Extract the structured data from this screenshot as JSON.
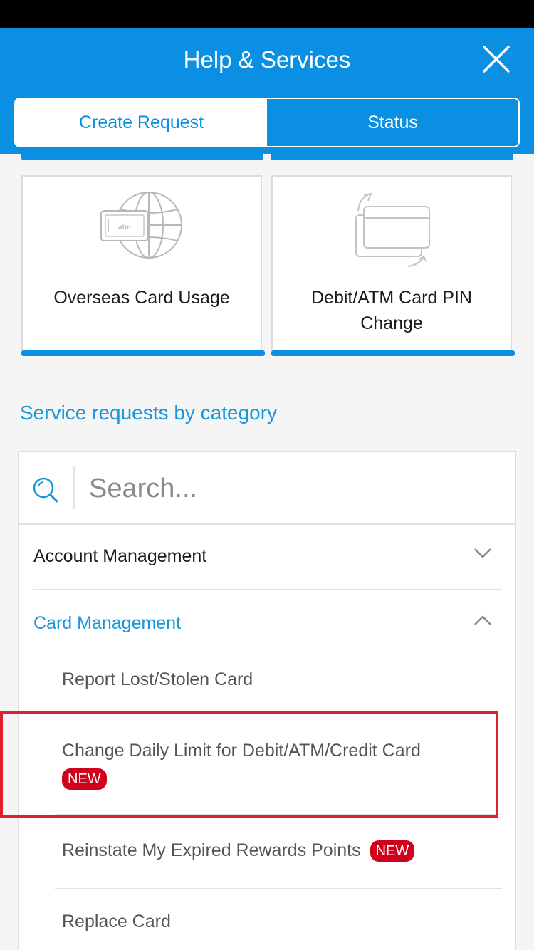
{
  "header": {
    "title": "Help & Services",
    "close_icon": "close-icon"
  },
  "tabs": [
    {
      "label": "Create Request",
      "active": true
    },
    {
      "label": "Status",
      "active": false
    }
  ],
  "tiles": [
    {
      "label": "Overseas Card Usage",
      "icon": "atm-card-globe-icon",
      "icon_text": "atm"
    },
    {
      "label": "Debit/ATM Card PIN Change",
      "icon": "card-swap-icon"
    }
  ],
  "section_title": "Service requests by category",
  "search": {
    "placeholder": "Search...",
    "value": ""
  },
  "categories": [
    {
      "label": "Account Management",
      "expanded": false
    },
    {
      "label": "Card Management",
      "expanded": true
    }
  ],
  "card_management_items": [
    {
      "label": "Report Lost/Stolen Card",
      "badge": ""
    },
    {
      "label": "Change Daily Limit for Debit/ATM/Credit Card",
      "badge": "NEW",
      "highlighted": true
    },
    {
      "label": "Reinstate My Expired Rewards Points",
      "badge": "NEW"
    },
    {
      "label": "Replace Card",
      "badge": ""
    }
  ],
  "colors": {
    "primary": "#0a8fe3",
    "link": "#1797dc",
    "badge": "#d0021b",
    "highlight": "#e0202e"
  }
}
